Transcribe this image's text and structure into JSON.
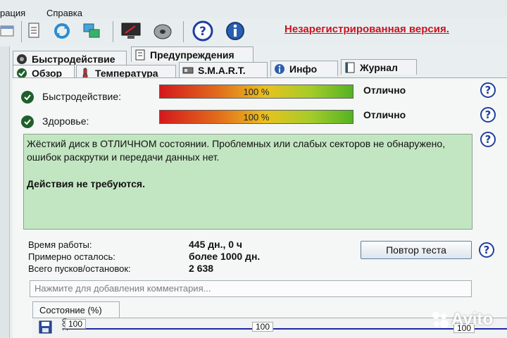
{
  "menu": [
    "рация",
    "Справка"
  ],
  "toolbar": {
    "icons": [
      "window-icon",
      "document-icon",
      "refresh-icon",
      "network-icon",
      "monitor-icon",
      "disk-icon",
      "help-icon",
      "info-icon"
    ],
    "unregistered": "Незарегистрированная версия."
  },
  "tabs_row1": [
    {
      "label": "Быстродействие",
      "icon": "performance-icon"
    },
    {
      "label": "Предупреждения",
      "icon": "warnings-icon"
    }
  ],
  "tabs_row2": [
    {
      "label": "Обзор",
      "icon": "overview-icon",
      "active": true
    },
    {
      "label": "Температура",
      "icon": "thermometer-icon"
    },
    {
      "label": "S.M.A.R.T.",
      "icon": "smart-icon"
    },
    {
      "label": "Инфо",
      "icon": "info-icon"
    },
    {
      "label": "Журнал",
      "icon": "journal-icon"
    }
  ],
  "performance": {
    "label": "Быстродействие:",
    "percent_text": "100 %",
    "value": 100,
    "status": "Отлично"
  },
  "health": {
    "label": "Здоровье:",
    "percent_text": "100 %",
    "value": 100,
    "status": "Отлично"
  },
  "summary": {
    "text": "Жёсткий диск в ОТЛИЧНОМ состоянии. Проблемных или слабых секторов не обнаружено, ошибок раскрутки и передачи данных нет.",
    "action": "Действия не требуются."
  },
  "stats": [
    {
      "label": "Время работы:",
      "value": "445 дн., 0 ч"
    },
    {
      "label": "Примерно осталось:",
      "value": "более 1000 дн."
    },
    {
      "label": "Всего пусков/остановок:",
      "value": "2 638"
    }
  ],
  "retest_label": "Повтор теста",
  "comment_placeholder": "Нажмите для добавления комментария...",
  "chart_tab": "Состояние (%)",
  "chart_points": [
    "100",
    "100",
    "100"
  ],
  "chart_ylabel": "100",
  "watermark": "Avito",
  "colors": {
    "accent_red": "#c8141e",
    "ok_green": "#1f5f2c",
    "summary_bg": "#c3e6c2",
    "help_blue": "#1f3f9e"
  }
}
